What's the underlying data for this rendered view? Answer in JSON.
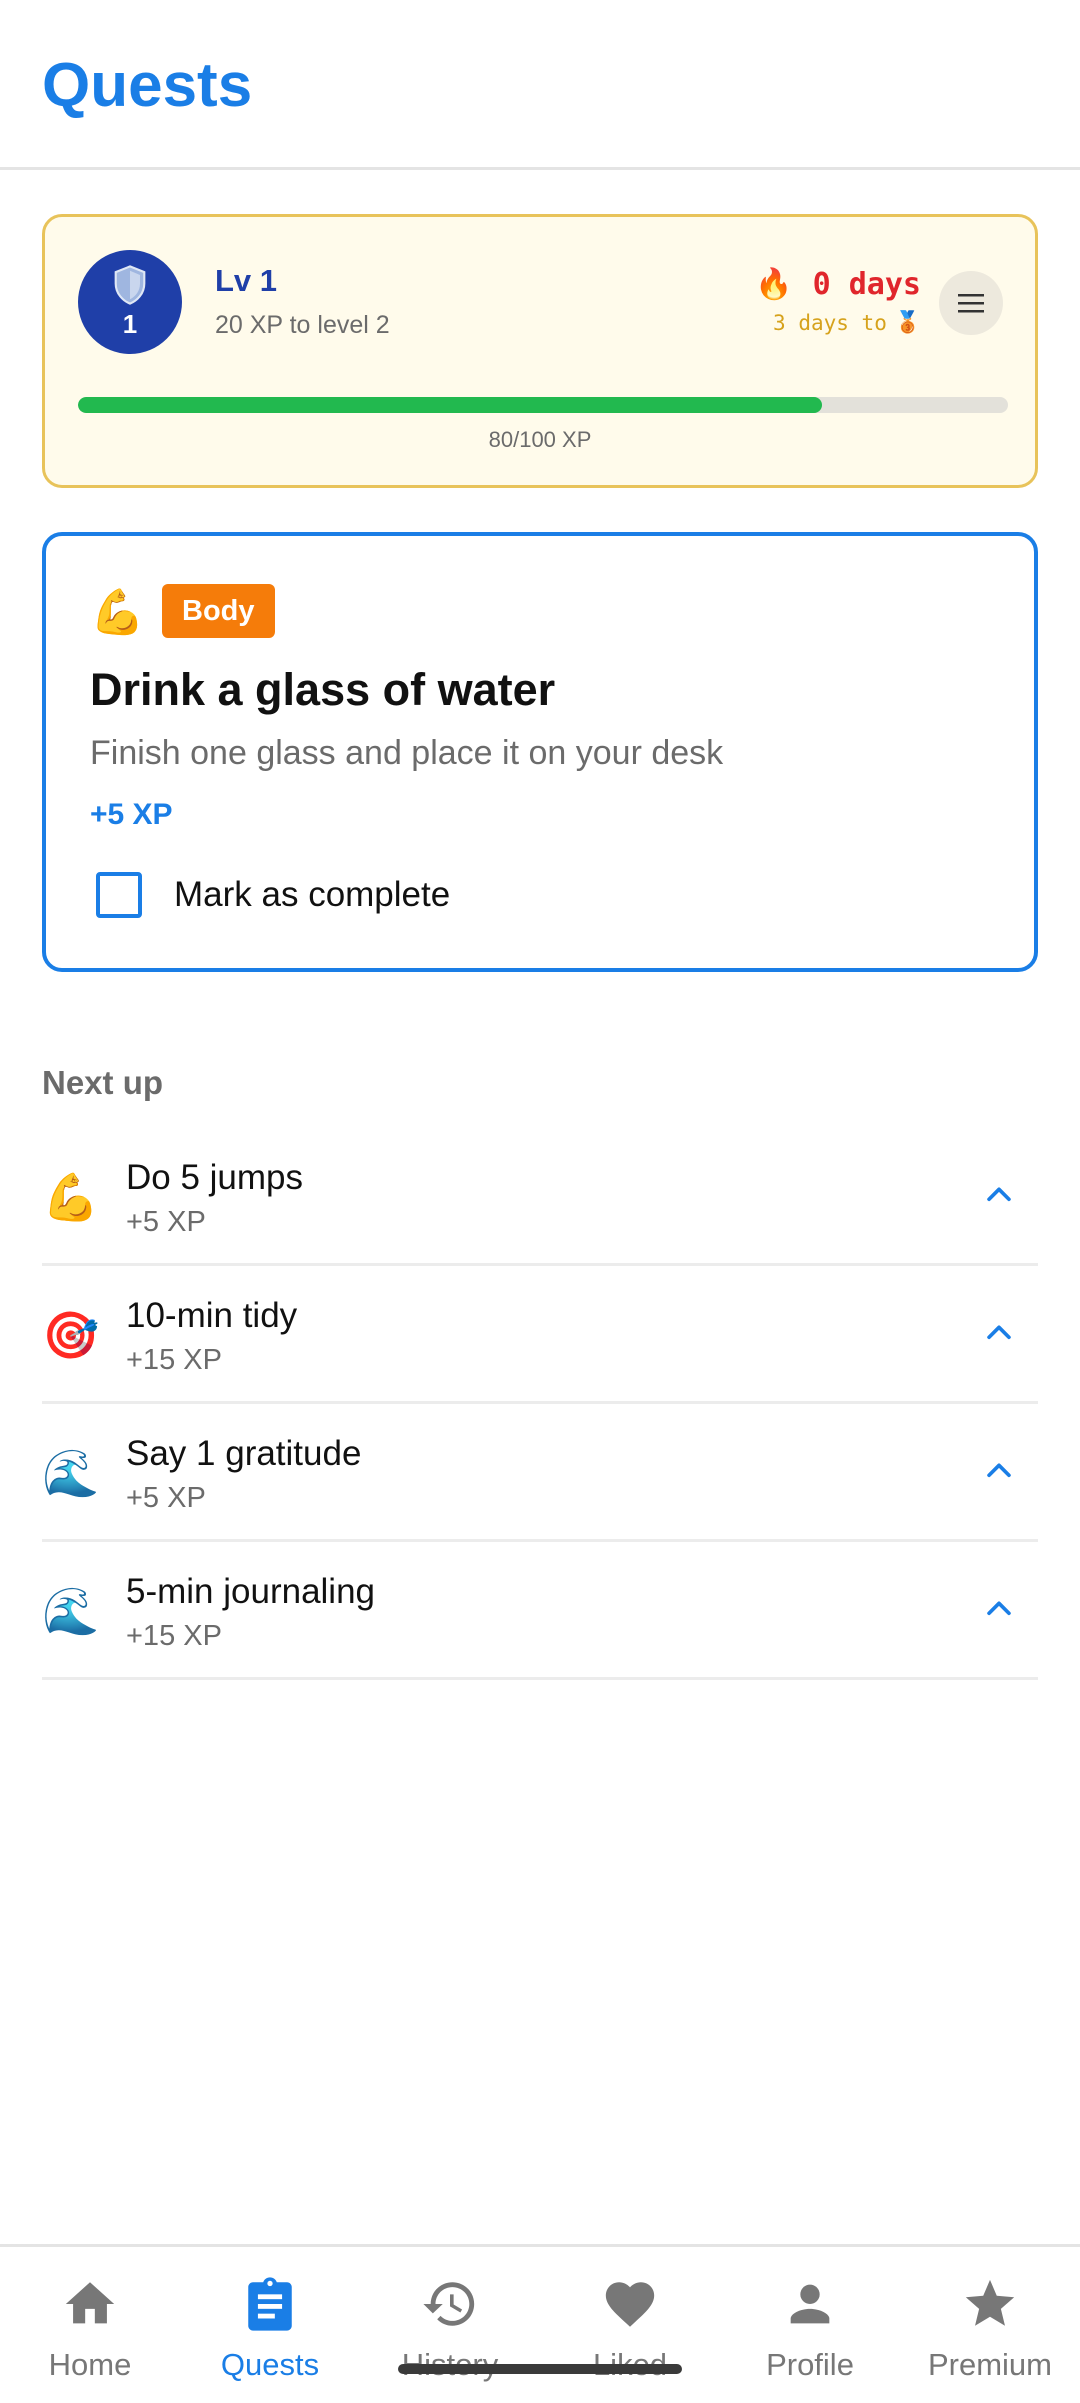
{
  "header": {
    "title": "Quests"
  },
  "level_card": {
    "avatar_level": "1",
    "level_label": "Lv 1",
    "xp_to_next": "20 XP to level 2",
    "streak_icon": "🔥",
    "streak_days": "0 days",
    "streak_goal": "3 days to",
    "streak_goal_icon": "🥉",
    "progress_fraction": 0.8,
    "progress_label": "80/100 XP"
  },
  "current_quest": {
    "emoji": "💪",
    "category": "Body",
    "title": "Drink a glass of water",
    "description": "Finish one glass and place it on your desk",
    "xp": "+5 XP",
    "complete_label": "Mark as complete"
  },
  "next_up": {
    "title": "Next up",
    "items": [
      {
        "emoji": "💪",
        "title": "Do 5 jumps",
        "xp": "+5 XP"
      },
      {
        "emoji": "🎯",
        "title": "10-min tidy",
        "xp": "+15 XP"
      },
      {
        "emoji": "🌊",
        "title": "Say 1 gratitude",
        "xp": "+5 XP"
      },
      {
        "emoji": "🌊",
        "title": "5-min journaling",
        "xp": "+15 XP"
      }
    ]
  },
  "nav": {
    "items": [
      {
        "label": "Home",
        "icon": "home-icon"
      },
      {
        "label": "Quests",
        "icon": "clipboard-icon",
        "active": true
      },
      {
        "label": "History",
        "icon": "history-icon"
      },
      {
        "label": "Liked",
        "icon": "heart-icon"
      },
      {
        "label": "Profile",
        "icon": "person-icon"
      },
      {
        "label": "Premium",
        "icon": "star-icon"
      }
    ]
  },
  "colors": {
    "accent": "#1a7ee6",
    "level_blue": "#1f3fa8",
    "progress_green": "#22b94f",
    "tag_orange": "#f57c0a",
    "streak_red": "#e0262c",
    "card_border_gold": "#e8c35a"
  }
}
